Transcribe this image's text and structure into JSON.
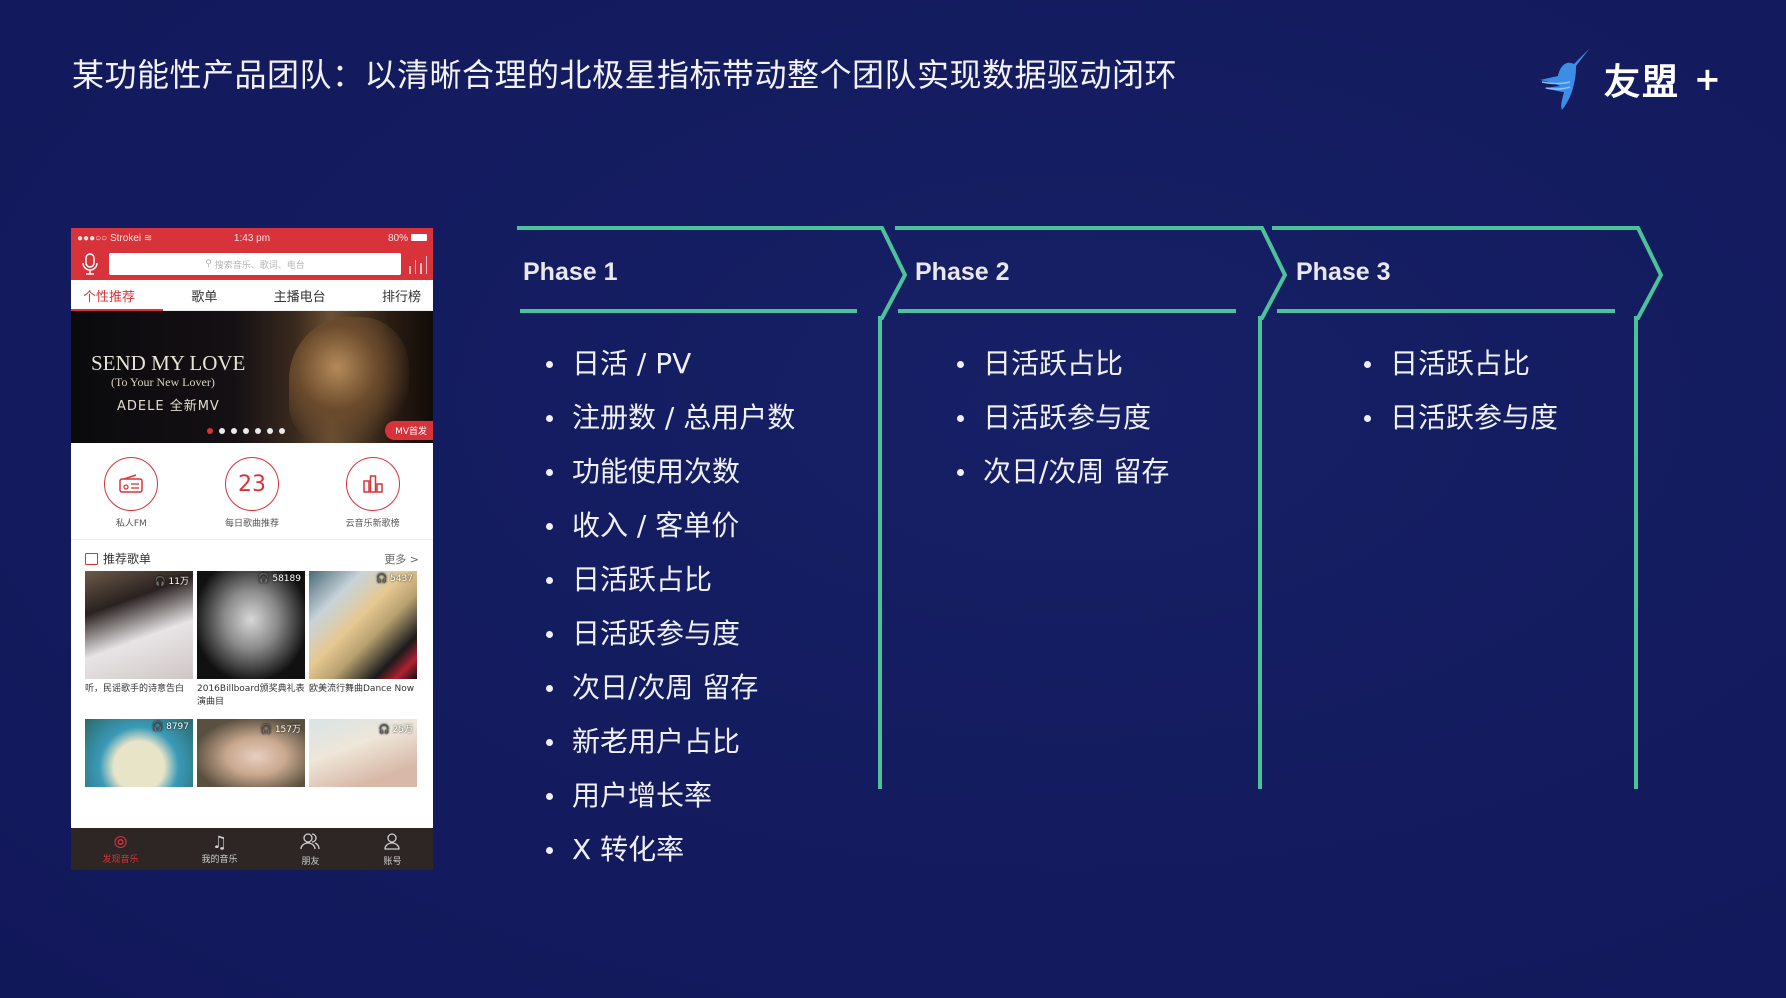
{
  "slide": {
    "title": "某功能性产品团队：以清晰合理的北极星指标带动整个团队实现数据驱动闭环",
    "logo": {
      "icon": "umeng-bird-icon",
      "text": "友盟",
      "plus": "+",
      "color": "#3d8de6"
    },
    "background_color": "#131a5e",
    "accent_color": "#4cc29a"
  },
  "phone": {
    "status": {
      "carrier": "●●●○○ Strokei",
      "wifi": "wifi-icon",
      "time": "1:43 pm",
      "battery": "80%"
    },
    "search_placeholder": "搜索音乐、歌词、电台",
    "tabs": [
      {
        "label": "个性推荐",
        "active": true
      },
      {
        "label": "歌单"
      },
      {
        "label": "主播电台"
      },
      {
        "label": "排行榜"
      }
    ],
    "banner": {
      "line1": "SEND MY LOVE",
      "line2": "(To Your New Lover)",
      "line3": "ADELE  全新MV",
      "tag": "MV首发",
      "slide_count": 7,
      "active_slide": 1
    },
    "shortcuts": [
      {
        "icon": "radio-icon",
        "glyph": "📻",
        "label": "私人FM"
      },
      {
        "icon": "calendar-number-icon",
        "glyph": "23",
        "label": "每日歌曲推荐"
      },
      {
        "icon": "chart-bars-icon",
        "glyph": "▟",
        "label": "云音乐新歌榜"
      }
    ],
    "section": {
      "title": "推荐歌单",
      "more": "更多 >"
    },
    "playlists": [
      {
        "count": "11万",
        "caption": "听，民谣歌手的诗意告白"
      },
      {
        "count": "58189",
        "caption": "2016Billboard颁奖典礼表演曲目"
      },
      {
        "count": "5437",
        "caption": "欧美流行舞曲Dance Now"
      }
    ],
    "playlists_row2": [
      {
        "count": "8797"
      },
      {
        "count": "157万"
      },
      {
        "count": "25万"
      }
    ],
    "tabbar": [
      {
        "icon": "netease-music-icon",
        "glyph": "⦾",
        "label": "发现音乐",
        "active": true
      },
      {
        "icon": "music-note-icon",
        "glyph": "♫",
        "label": "我的音乐"
      },
      {
        "icon": "friends-icon",
        "glyph": "👥",
        "label": "朋友"
      },
      {
        "icon": "account-icon",
        "glyph": "👤",
        "label": "账号"
      }
    ]
  },
  "phases": [
    {
      "label": "Phase 1",
      "items": [
        "日活 / PV",
        "注册数 / 总用户数",
        "功能使用次数",
        "收入 / 客单价",
        "日活跃占比",
        "日活跃参与度",
        "次日/次周 留存",
        "新老用户占比",
        "用户增长率",
        "X 转化率"
      ]
    },
    {
      "label": "Phase 2",
      "items": [
        "日活跃占比",
        "日活跃参与度",
        "次日/次周 留存"
      ]
    },
    {
      "label": "Phase 3",
      "items": [
        "日活跃占比",
        "日活跃参与度"
      ]
    }
  ]
}
